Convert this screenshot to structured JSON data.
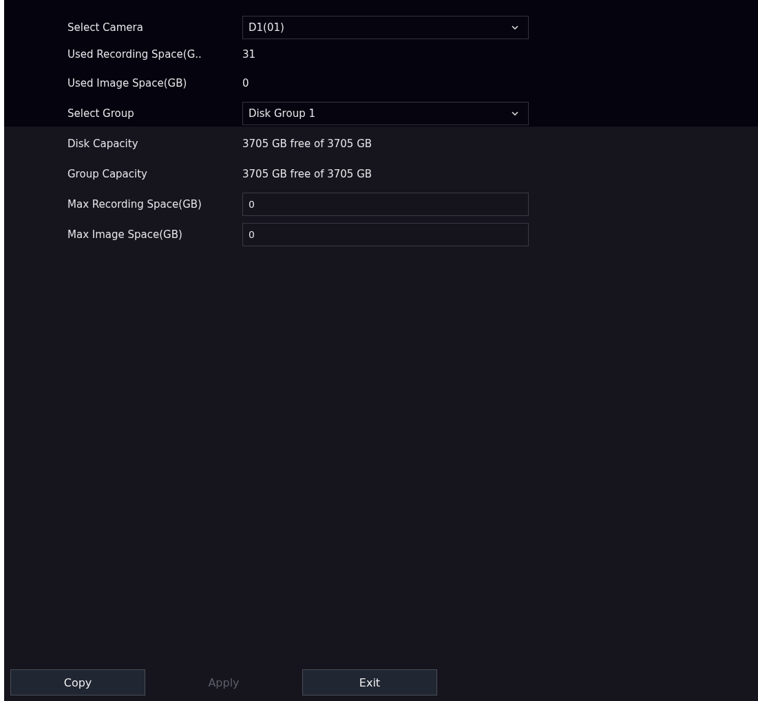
{
  "fields": [
    {
      "label": "Select Camera",
      "kind": "select",
      "value": "D1(01)"
    },
    {
      "label": "Used Recording Space(G..",
      "kind": "text",
      "value": "31"
    },
    {
      "label": "Used Image Space(GB)",
      "kind": "text",
      "value": "0"
    },
    {
      "label": "Select Group",
      "kind": "select",
      "value": "Disk Group 1"
    },
    {
      "label": "Disk Capacity",
      "kind": "text",
      "value": "3705 GB free of 3705 GB"
    },
    {
      "label": "Group Capacity",
      "kind": "text",
      "value": "3705 GB free of 3705 GB"
    },
    {
      "label": "Max Recording Space(GB)",
      "kind": "input",
      "value": "0"
    },
    {
      "label": "Max Image Space(GB)",
      "kind": "input",
      "value": "0"
    }
  ],
  "buttons": [
    {
      "label": "Copy",
      "disabled": false
    },
    {
      "label": "Apply",
      "disabled": true
    },
    {
      "label": "Exit",
      "disabled": false
    }
  ]
}
